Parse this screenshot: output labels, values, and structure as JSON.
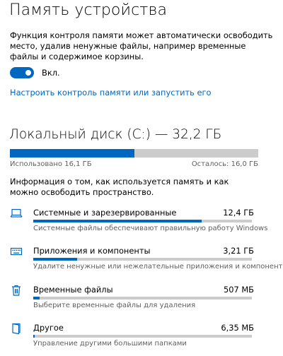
{
  "page": {
    "title": "Память устройства",
    "description": "Функция контроля памяти может автоматически освободить место, удалив ненужные файлы, например временные файлы и содержимое корзины.",
    "toggle_state": "Вкл.",
    "toggle_on": true,
    "configure_link": "Настроить контроль памяти или запустить его"
  },
  "disk": {
    "title": "Локальный диск (C:) — 32,2 ГБ",
    "used_label": "Использовано 16,1 ГБ",
    "free_label": "Осталось: 16,0 ГБ",
    "used_fraction": 0.5,
    "info": "Информация о том, как используется память и как можно освободить пространство."
  },
  "categories": [
    {
      "name": "Системные и зарезервированные",
      "size": "12,4 ГБ",
      "description": "Системные файлы обеспечивают правильную работу Windows",
      "icon": "laptop-icon",
      "fraction": 0.77
    },
    {
      "name": "Приложения и компоненты",
      "size": "3,21 ГБ",
      "description": "Удалите ненужные или нежелательные приложения и компоненты",
      "icon": "keyboard-icon",
      "fraction": 0.2
    },
    {
      "name": "Временные файлы",
      "size": "507 МБ",
      "description": "Выберите временные файлы для удаления",
      "icon": "trash-icon",
      "fraction": 0.03
    },
    {
      "name": "Другое",
      "size": "6,35 МБ",
      "description": "Управление другими большими папками",
      "icon": "folder-icon",
      "fraction": 0.005
    }
  ],
  "colors": {
    "accent": "#0067c0",
    "track": "#cccccc",
    "secondary_text": "#5f5f5f"
  }
}
